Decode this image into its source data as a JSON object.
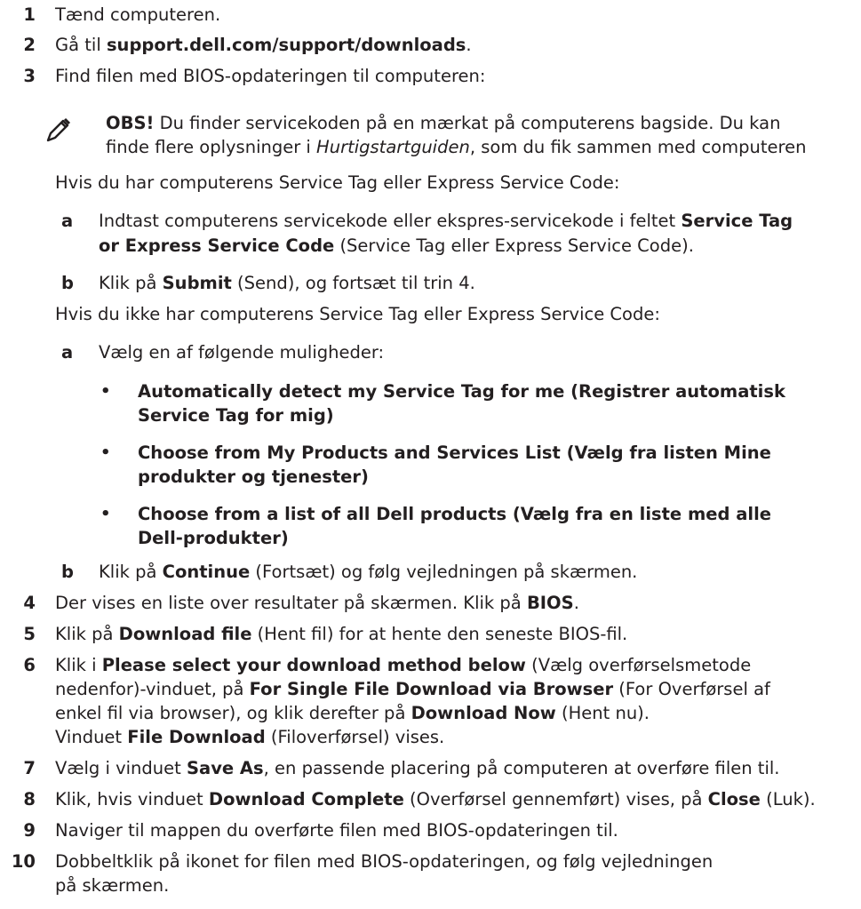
{
  "steps": [
    {
      "num": "1",
      "segs": [
        {
          "t": "Tænd computeren."
        }
      ]
    },
    {
      "num": "2",
      "segs": [
        {
          "t": "Gå til "
        },
        {
          "t": "support.dell.com/support/downloads",
          "b": true
        },
        {
          "t": "."
        }
      ]
    },
    {
      "num": "3",
      "segs": [
        {
          "t": "Find filen med BIOS-opdateringen til computeren:"
        }
      ]
    },
    {
      "num": "4",
      "segs": [
        {
          "t": "Der vises en liste over resultater på skærmen. Klik på "
        },
        {
          "t": "BIOS",
          "b": true
        },
        {
          "t": "."
        }
      ]
    },
    {
      "num": "5",
      "segs": [
        {
          "t": "Klik på "
        },
        {
          "t": "Download file",
          "b": true
        },
        {
          "t": " (Hent fil) for at hente den seneste BIOS-fil."
        }
      ]
    },
    {
      "num": "6",
      "lines": [
        [
          {
            "t": "Klik i "
          },
          {
            "t": "Please select your download method below",
            "b": true
          },
          {
            "t": " (Vælg overførselsmetode"
          }
        ],
        [
          {
            "t": "nedenfor)-vinduet, på "
          },
          {
            "t": "For Single File Download via Browser",
            "b": true
          },
          {
            "t": " (For Overførsel af"
          }
        ],
        [
          {
            "t": "enkel fil via browser), og klik derefter på "
          },
          {
            "t": "Download Now",
            "b": true
          },
          {
            "t": " (Hent nu)."
          }
        ],
        [
          {
            "t": "Vinduet "
          },
          {
            "t": "File Download",
            "b": true
          },
          {
            "t": " (Filoverførsel) vises."
          }
        ]
      ]
    },
    {
      "num": "7",
      "segs": [
        {
          "t": "Vælg i vinduet "
        },
        {
          "t": "Save As",
          "b": true
        },
        {
          "t": ", en passende placering på computeren at overføre filen til."
        }
      ]
    },
    {
      "num": "8",
      "segs": [
        {
          "t": "Klik, hvis vinduet "
        },
        {
          "t": "Download Complete",
          "b": true
        },
        {
          "t": " (Overførsel gennemført) vises, på "
        },
        {
          "t": "Close",
          "b": true
        },
        {
          "t": " (Luk)."
        }
      ]
    },
    {
      "num": "9",
      "segs": [
        {
          "t": "Naviger til mappen du overførte filen med BIOS-opdateringen til."
        }
      ]
    },
    {
      "num": "10",
      "lines": [
        [
          {
            "t": "Dobbeltklik på ikonet for filen med BIOS-opdateringen, og følg vejledningen"
          }
        ],
        [
          {
            "t": "på skærmen."
          }
        ]
      ]
    }
  ],
  "note": {
    "icon": "pencil-note-icon",
    "lines": [
      [
        {
          "t": "OBS!",
          "b": true
        },
        {
          "t": " Du finder servicekoden på en mærkat på computerens bagside. Du kan"
        }
      ],
      [
        {
          "t": "finde flere oplysninger i "
        },
        {
          "t": "Hurtigstartguiden",
          "i": true
        },
        {
          "t": ", som du fik sammen med computeren"
        }
      ]
    ]
  },
  "if_have": "Hvis du har computerens Service Tag eller Express Service Code:",
  "have_steps": [
    {
      "label": "a",
      "lines": [
        [
          {
            "t": "Indtast computerens servicekode eller ekspres-servicekode i feltet "
          },
          {
            "t": "Service Tag",
            "b": true
          }
        ],
        [
          {
            "t": "or Express Service Code",
            "b": true
          },
          {
            "t": " (Service Tag eller Express Service Code)."
          }
        ]
      ]
    },
    {
      "label": "b",
      "lines": [
        [
          {
            "t": "Klik på "
          },
          {
            "t": "Submit",
            "b": true
          },
          {
            "t": " (Send), og fortsæt til trin 4."
          }
        ]
      ]
    }
  ],
  "if_not": "Hvis du ikke har computerens Service Tag eller Express Service Code:",
  "not_steps": [
    {
      "label": "a",
      "text": "Vælg en af følgende muligheder:"
    },
    {
      "label": "b",
      "lines": [
        [
          {
            "t": "Klik på "
          },
          {
            "t": "Continue",
            "b": true
          },
          {
            "t": " (Fortsæt) og følg vejledningen på skærmen."
          }
        ]
      ]
    }
  ],
  "options": [
    {
      "bullet": "•",
      "lines": [
        "Automatically detect my Service Tag for me (Registrer automatisk",
        "Service Tag for mig)"
      ]
    },
    {
      "bullet": "•",
      "lines": [
        "Choose from My Products and Services List (Vælg fra listen Mine",
        "produkter og tjenester)"
      ]
    },
    {
      "bullet": "•",
      "lines": [
        "Choose from a list of all Dell products (Vælg fra en liste med alle",
        "Dell-produkter)"
      ]
    }
  ]
}
